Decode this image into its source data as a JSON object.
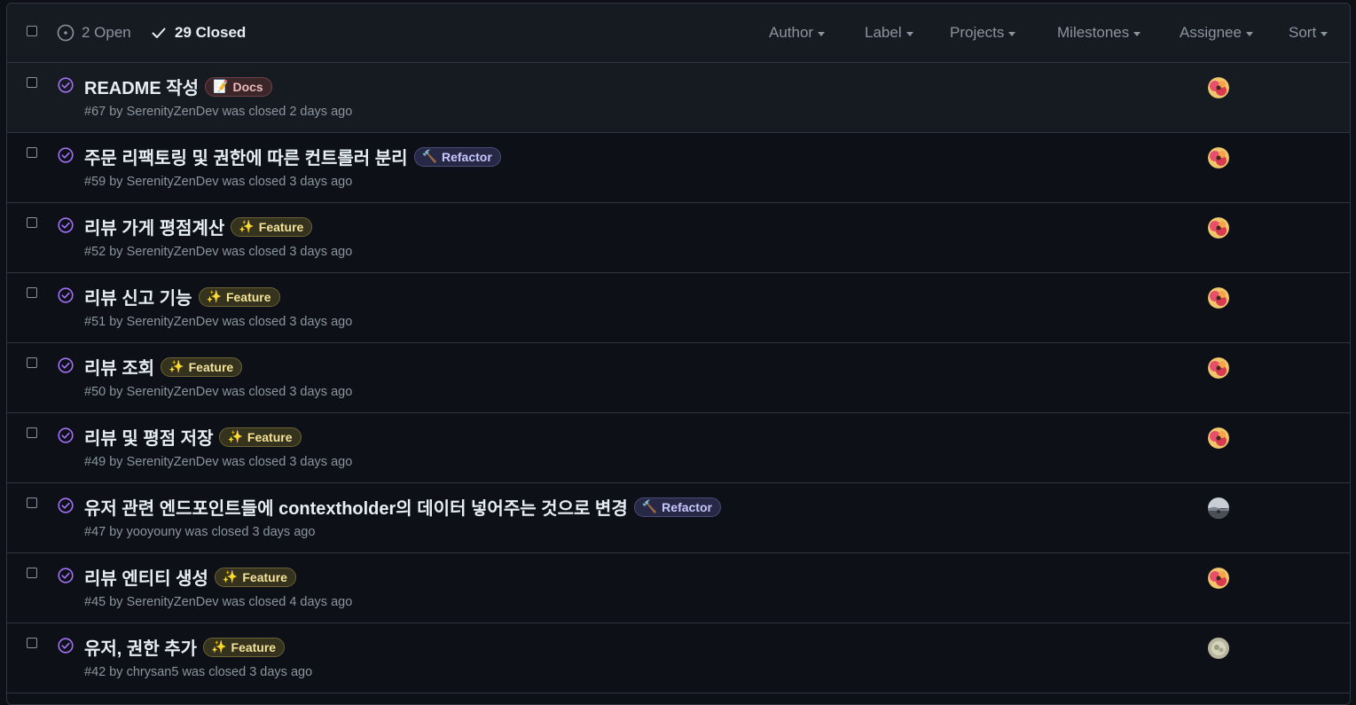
{
  "header": {
    "open_label": "2 Open",
    "closed_label": "29 Closed",
    "filters": [
      {
        "label": "Author",
        "name": "author"
      },
      {
        "label": "Label",
        "name": "label"
      },
      {
        "label": "Projects",
        "name": "projects"
      },
      {
        "label": "Milestones",
        "name": "milestones"
      },
      {
        "label": "Assignee",
        "name": "assignee"
      },
      {
        "label": "Sort",
        "name": "sort"
      }
    ]
  },
  "colors": {
    "closed_icon": "#a371f7",
    "muted": "#8b949e",
    "border": "#30363d",
    "header_bg": "#161b22",
    "page_bg": "#0d1117"
  },
  "labels": {
    "docs": {
      "text": "Docs",
      "icon": "memo-emoji",
      "glyph": "📝",
      "color": "#f0b8b8",
      "bg": "#3a2529",
      "border": "#6e4148"
    },
    "refactor": {
      "text": "Refactor",
      "icon": "hammer-emoji",
      "glyph": "🔨",
      "color": "#c8c8ff",
      "bg": "#262845",
      "border": "#4a4c7a"
    },
    "feature": {
      "text": "Feature",
      "icon": "sparkles-emoji",
      "glyph": "✨",
      "color": "#f3e29a",
      "bg": "#35321d",
      "border": "#6a6234"
    }
  },
  "issues": [
    {
      "title": "README 작성",
      "label": "docs",
      "number": "#67",
      "by": " by ",
      "author": "SerenityZenDev",
      "closed_text": " was closed 2 days ago",
      "avatar": "avatar-serenity"
    },
    {
      "title": "주문 리팩토링 및 권한에 따른 컨트롤러 분리",
      "label": "refactor",
      "number": "#59",
      "by": " by ",
      "author": "SerenityZenDev",
      "closed_text": " was closed 3 days ago",
      "avatar": "avatar-serenity"
    },
    {
      "title": "리뷰 가게 평점계산",
      "label": "feature",
      "number": "#52",
      "by": " by ",
      "author": "SerenityZenDev",
      "closed_text": " was closed 3 days ago",
      "avatar": "avatar-serenity"
    },
    {
      "title": "리뷰 신고 기능",
      "label": "feature",
      "number": "#51",
      "by": " by ",
      "author": "SerenityZenDev",
      "closed_text": " was closed 3 days ago",
      "avatar": "avatar-serenity"
    },
    {
      "title": "리뷰 조회",
      "label": "feature",
      "number": "#50",
      "by": " by ",
      "author": "SerenityZenDev",
      "closed_text": " was closed 3 days ago",
      "avatar": "avatar-serenity"
    },
    {
      "title": "리뷰 및 평점 저장",
      "label": "feature",
      "number": "#49",
      "by": " by ",
      "author": "SerenityZenDev",
      "closed_text": " was closed 3 days ago",
      "avatar": "avatar-serenity"
    },
    {
      "title": "유저 관련 엔드포인트들에 contextholder의 데이터 넣어주는 것으로 변경",
      "label": "refactor",
      "number": "#47",
      "by": " by ",
      "author": "yooyouny",
      "closed_text": " was closed 3 days ago",
      "avatar": "avatar-yooyouny"
    },
    {
      "title": "리뷰 엔티티 생성",
      "label": "feature",
      "number": "#45",
      "by": " by ",
      "author": "SerenityZenDev",
      "closed_text": " was closed 4 days ago",
      "avatar": "avatar-serenity"
    },
    {
      "title": "유저, 권한 추가",
      "label": "feature",
      "number": "#42",
      "by": " by ",
      "author": "chrysan5",
      "closed_text": " was closed 3 days ago",
      "avatar": "avatar-chrysan5"
    }
  ]
}
